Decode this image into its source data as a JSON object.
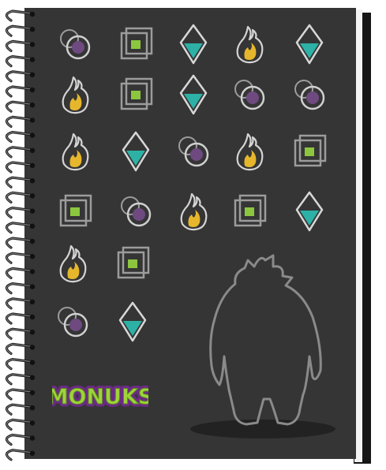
{
  "brand": {
    "logo_text": "MONUKS"
  },
  "colors": {
    "cover": "#353535",
    "cover_edge": "#111111",
    "icon_stroke": "#9c9c9c",
    "purple": "#6e4a80",
    "teal": "#2db1a6",
    "fire_yellow": "#e6b72c",
    "square_green": "#8cc63f",
    "logo_fill": "#9fd33b",
    "logo_outline": "#6b2a86",
    "wire": "#2a2a2a"
  },
  "pattern": {
    "rows": [
      [
        "ring-dot-icon",
        "squares-icon",
        "diamond-icon",
        "flame-icon",
        "diamond-icon"
      ],
      [
        "flame-icon",
        "squares-icon",
        "diamond-icon",
        "ring-dot-icon",
        "ring-dot-icon"
      ],
      [
        "flame-icon",
        "diamond-icon",
        "ring-dot-icon",
        "flame-icon",
        "squares-icon"
      ],
      [
        "squares-icon",
        "ring-dot-icon",
        "flame-icon",
        "squares-icon",
        "diamond-icon"
      ],
      [
        "flame-icon",
        "squares-icon"
      ],
      [
        "ring-dot-icon",
        "diamond-icon"
      ]
    ]
  }
}
